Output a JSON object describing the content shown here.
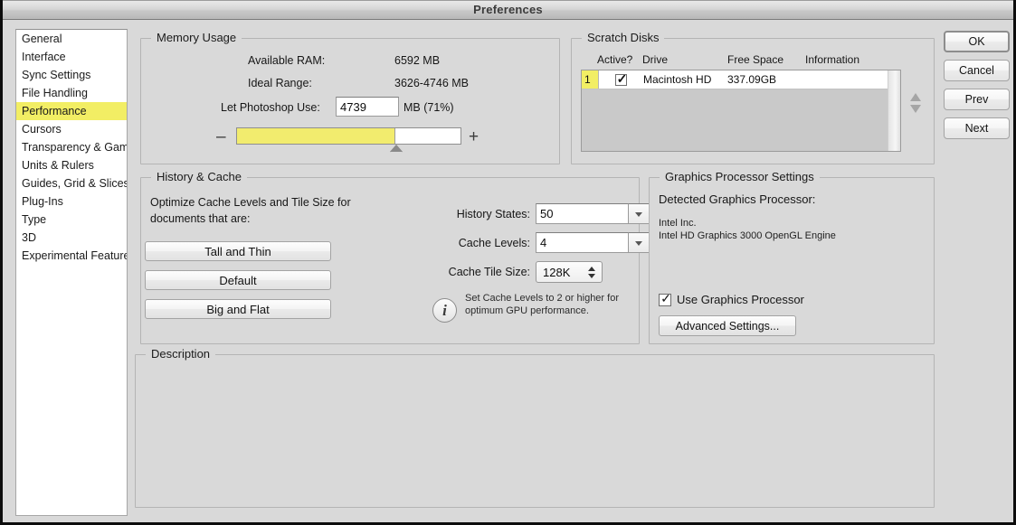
{
  "window": {
    "title": "Preferences"
  },
  "sidebar": {
    "items": [
      {
        "label": "General",
        "selected": false
      },
      {
        "label": "Interface",
        "selected": false
      },
      {
        "label": "Sync Settings",
        "selected": false
      },
      {
        "label": "File Handling",
        "selected": false
      },
      {
        "label": "Performance",
        "selected": true
      },
      {
        "label": "Cursors",
        "selected": false
      },
      {
        "label": "Transparency & Gamut",
        "selected": false
      },
      {
        "label": "Units & Rulers",
        "selected": false
      },
      {
        "label": "Guides, Grid & Slices",
        "selected": false
      },
      {
        "label": "Plug-Ins",
        "selected": false
      },
      {
        "label": "Type",
        "selected": false
      },
      {
        "label": "3D",
        "selected": false
      },
      {
        "label": "Experimental Features",
        "selected": false
      }
    ],
    "selected_color": "#f2ee64"
  },
  "memory_usage": {
    "legend": "Memory Usage",
    "available_ram_label": "Available RAM:",
    "available_ram_value": "6592 MB",
    "ideal_range_label": "Ideal Range:",
    "ideal_range_value": "3626-4746 MB",
    "let_photoshop_use_label": "Let Photoshop Use:",
    "let_photoshop_use_value": "4739",
    "unit_text": "MB (71%)",
    "slider": {
      "minus": "–",
      "plus": "+",
      "percent": 71,
      "fill_color": "#f2ec6e"
    }
  },
  "scratch_disks": {
    "legend": "Scratch Disks",
    "columns": [
      "Active?",
      "Drive",
      "Free Space",
      "Information"
    ],
    "rows": [
      {
        "index": "1",
        "active": true,
        "drive": "Macintosh HD",
        "free_space": "337.09GB",
        "information": ""
      }
    ],
    "reorder_up": "move-up-arrow",
    "reorder_down": "move-down-arrow"
  },
  "history_cache": {
    "legend": "History & Cache",
    "optimize_text": "Optimize Cache Levels and Tile Size for documents that are:",
    "preset_buttons": [
      "Tall and Thin",
      "Default",
      "Big and Flat"
    ],
    "history_states_label": "History States:",
    "history_states_value": "50",
    "cache_levels_label": "Cache Levels:",
    "cache_levels_value": "4",
    "cache_tile_size_label": "Cache Tile Size:",
    "cache_tile_size_value": "128K",
    "info_glyph": "i",
    "info_text": "Set Cache Levels to 2 or higher for optimum GPU performance."
  },
  "graphics_processor": {
    "legend": "Graphics Processor Settings",
    "detected_label": "Detected Graphics Processor:",
    "vendor": "Intel Inc.",
    "model": "Intel HD Graphics 3000 OpenGL Engine",
    "use_gpu_label": "Use Graphics Processor",
    "use_gpu_checked": true,
    "advanced_button": "Advanced Settings..."
  },
  "description": {
    "legend": "Description",
    "text": ""
  },
  "buttons": {
    "ok": "OK",
    "cancel": "Cancel",
    "prev": "Prev",
    "next": "Next"
  }
}
